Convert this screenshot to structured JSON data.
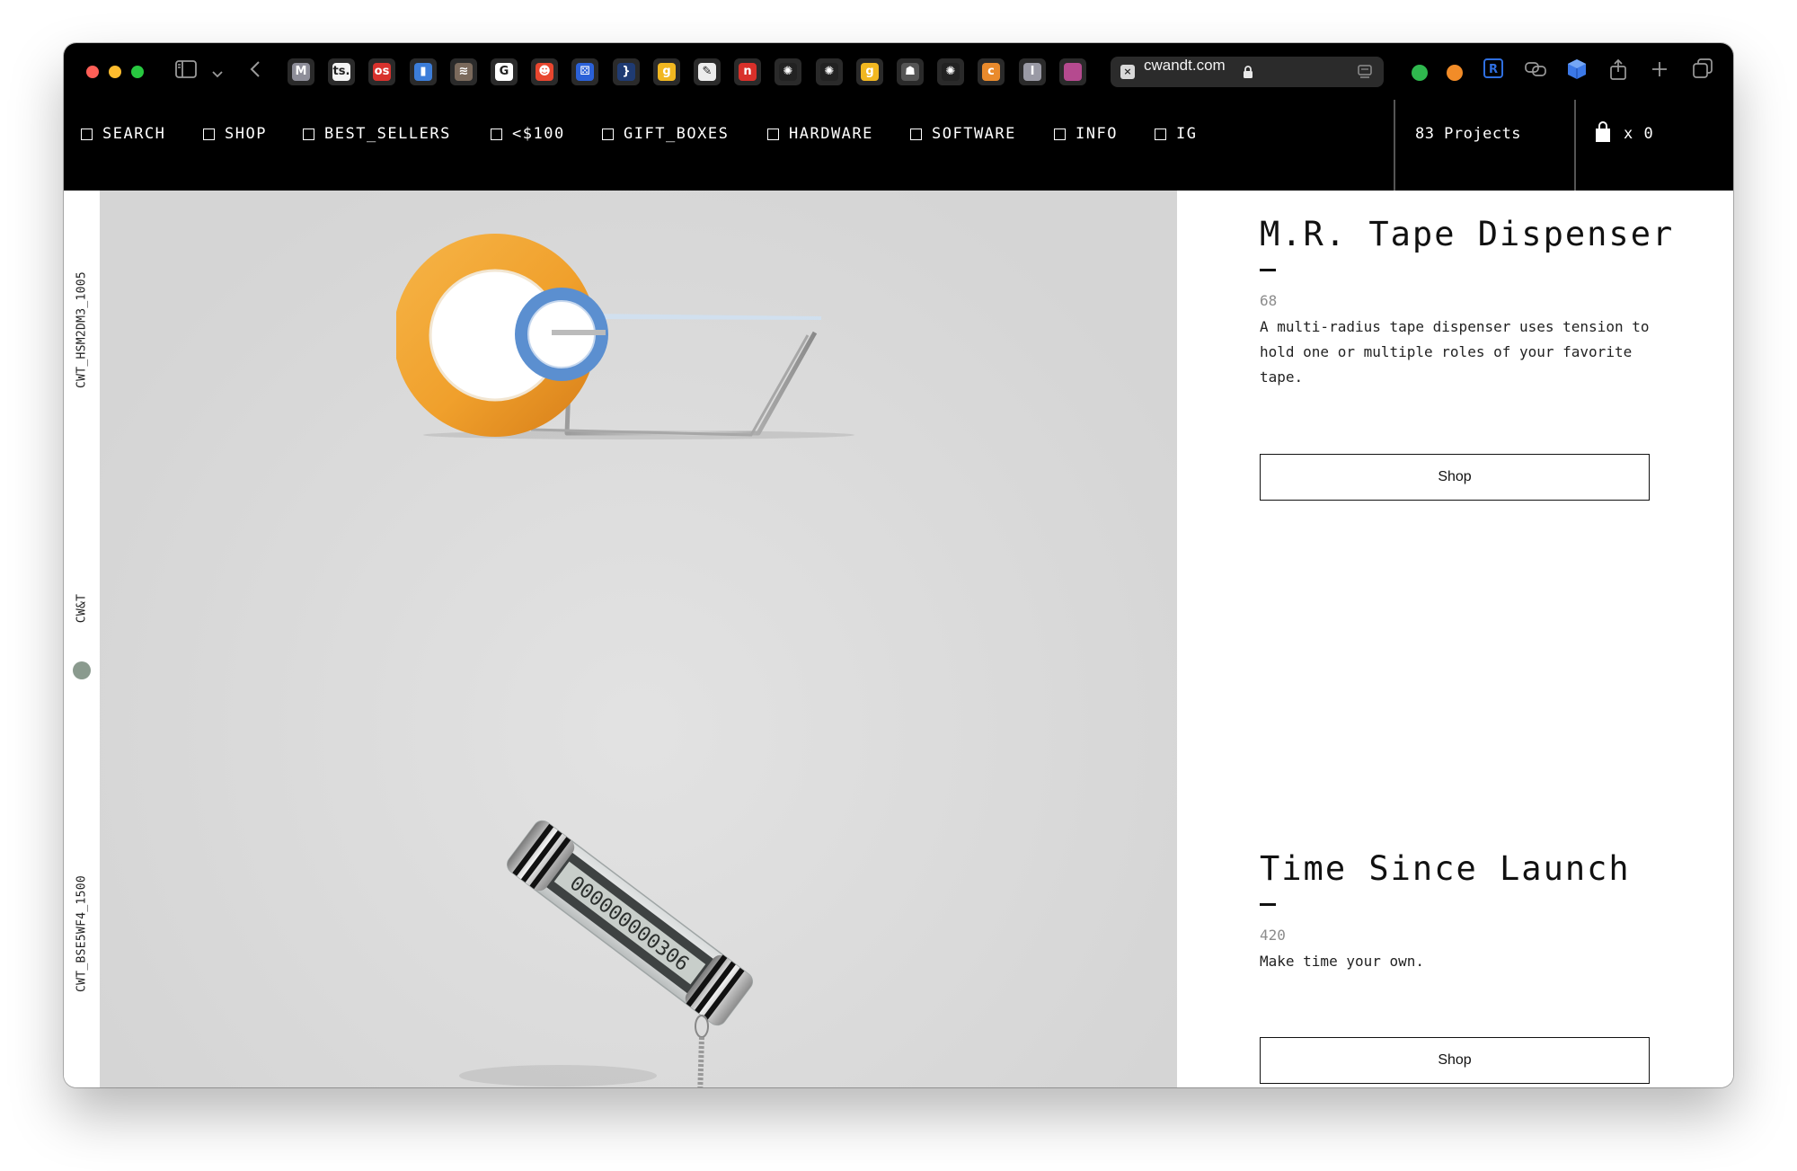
{
  "browser": {
    "url": "cwandt.com",
    "tab_favicons": [
      {
        "name": "m-favicon",
        "glyph": "M",
        "bg": "#8e8e99"
      },
      {
        "name": "ts-favicon",
        "glyph": "ts.",
        "bg": "#f4f4f4"
      },
      {
        "name": "os-favicon",
        "glyph": "os",
        "bg": "#d8322d"
      },
      {
        "name": "bookmark-favicon",
        "glyph": "▮",
        "bg": "#3c7dd9"
      },
      {
        "name": "ribbon-favicon",
        "glyph": "≋",
        "bg": "#7b6a5c"
      },
      {
        "name": "google-favicon",
        "glyph": "G",
        "bg": "#ffffff"
      },
      {
        "name": "red-face-favicon",
        "glyph": "☻",
        "bg": "#e8462f"
      },
      {
        "name": "dice-favicon",
        "glyph": "⚄",
        "bg": "#2b61d8"
      },
      {
        "name": "braces-favicon",
        "glyph": "}",
        "bg": "#1f3b73"
      },
      {
        "name": "g-yellow-favicon",
        "glyph": "g",
        "bg": "#f1b720"
      },
      {
        "name": "pen-favicon",
        "glyph": "✎",
        "bg": "#ececec"
      },
      {
        "name": "n-red-favicon",
        "glyph": "n",
        "bg": "#d9302a"
      },
      {
        "name": "openai-favicon",
        "glyph": "✺",
        "bg": "#222222"
      },
      {
        "name": "openai-favicon-2",
        "glyph": "✺",
        "bg": "#222222"
      },
      {
        "name": "g-yellow-favicon-2",
        "glyph": "g",
        "bg": "#f1b720"
      },
      {
        "name": "robot-favicon",
        "glyph": "☗",
        "bg": "#555555"
      },
      {
        "name": "openai-favicon-3",
        "glyph": "✺",
        "bg": "#222222"
      },
      {
        "name": "orange-c-favicon",
        "glyph": "c",
        "bg": "#e98a2c"
      },
      {
        "name": "i-favicon",
        "glyph": "I",
        "bg": "#9a9aa5"
      },
      {
        "name": "gradient-favicon",
        "glyph": "",
        "bg": "#b54a8f"
      }
    ]
  },
  "nav": {
    "items": [
      "SEARCH",
      "SHOP",
      "BEST_SELLERS",
      "<$100",
      "GIFT_BOXES",
      "HARDWARE",
      "SOFTWARE",
      "INFO",
      "IG"
    ],
    "projects_count": "83 Projects",
    "cart_count": "x 0"
  },
  "rail": {
    "top_label": "CWT_HSM2DM3_1005",
    "middle_label": "CW&T",
    "bottom_label": "CWT_BSE5WF4_1500"
  },
  "products": [
    {
      "title": "M.R. Tape Dispenser",
      "price": "68",
      "description": "A multi-radius tape dispenser uses tension to hold one or multiple roles of your favorite tape.",
      "button": "Shop"
    },
    {
      "title": "Time Since Launch",
      "price": "420",
      "description": "Make time your own.",
      "button": "Shop",
      "counter_reading": "000000000306"
    }
  ],
  "colors": {
    "chrome": "#000000",
    "gallery_bg": "#dcdcdc",
    "rail_dot": "#8a9a8e",
    "tape_orange": "#f0a02c",
    "tape_blue": "#5b8fd0"
  }
}
